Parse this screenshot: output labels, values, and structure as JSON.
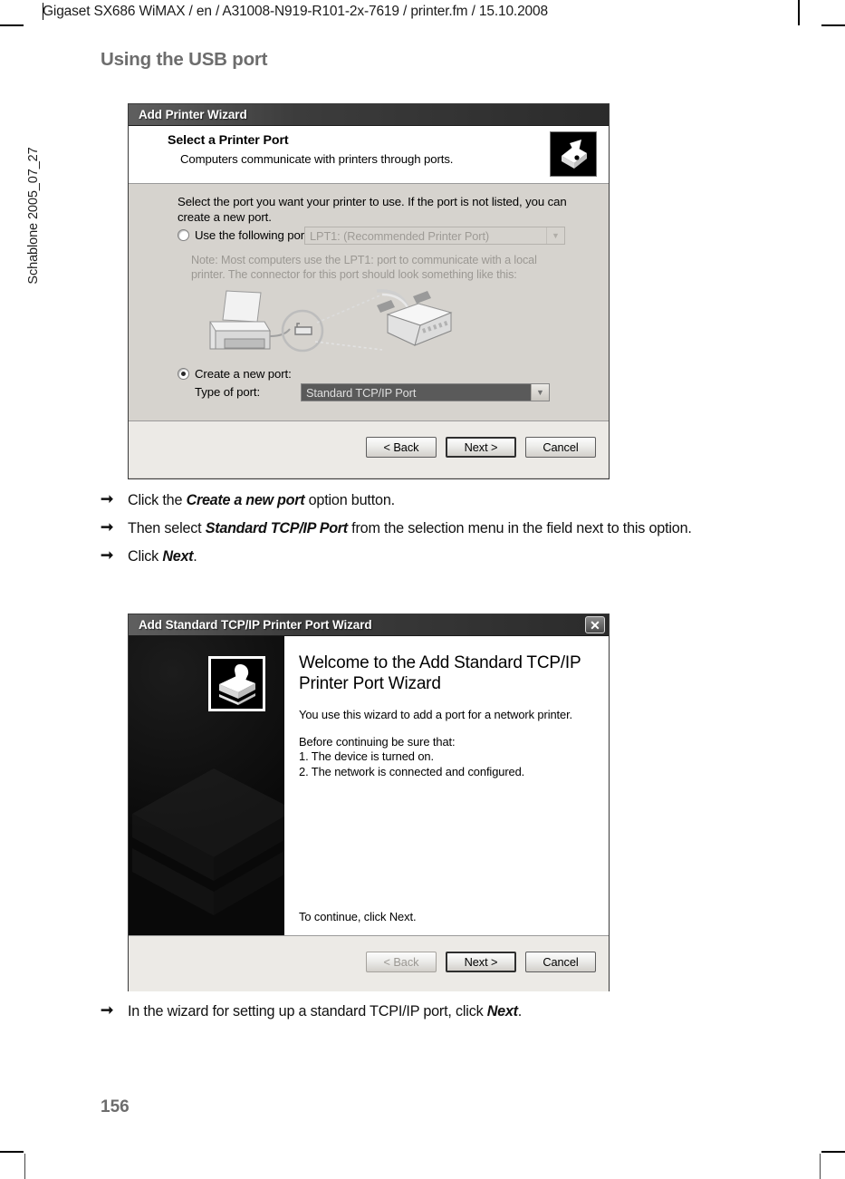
{
  "document": {
    "header": "Gigaset SX686 WiMAX / en / A31008-N919-R101-2x-7619 / printer.fm / 15.10.2008",
    "side_label": "Schablone 2005_07_27",
    "section_title": "Using the USB port",
    "page_number": "156"
  },
  "dialog_printer_port": {
    "title": "Add Printer Wizard",
    "header_title": "Select a Printer Port",
    "header_subtitle": "Computers communicate with printers through ports.",
    "header_icon": "printer-port-icon",
    "instruction": "Select the port you want your printer to use.  If the port is not listed, you can create a new port.",
    "use_following_port_label": "Use the following port:",
    "use_following_port_checked": false,
    "port_combo_value": "LPT1: (Recommended Printer Port)",
    "port_combo_disabled": true,
    "note": "Note: Most computers use the LPT1: port to communicate with a local printer. The connector for this port should look something like this:",
    "illustration": "printer-parallel-connector-illustration",
    "create_new_port_label": "Create a new port:",
    "create_new_port_checked": true,
    "type_of_port_label": "Type of port:",
    "type_combo_value": "Standard TCP/IP Port",
    "type_combo_selected": true,
    "buttons": {
      "back": "< Back",
      "next": "Next >",
      "cancel": "Cancel"
    }
  },
  "steps_after_first_dialog": [
    {
      "prefix": "Click the ",
      "bold": "Create a new port",
      "suffix": " option button."
    },
    {
      "prefix": "Then select ",
      "bold": "Standard TCP/IP Port",
      "suffix": " from the selection menu in the field next to this option."
    },
    {
      "prefix": "Click ",
      "bold": "Next",
      "suffix": "."
    }
  ],
  "dialog_tcpip_wizard": {
    "title": "Add Standard TCP/IP Printer Port Wizard",
    "close_label": "✕",
    "badge_icon": "printer-stack-icon",
    "welcome_title": "Welcome to the Add Standard TCP/IP Printer Port Wizard",
    "paragraph": "You use this wizard to add a port for a network printer.",
    "before_continuing": "Before continuing be sure that:",
    "checklist": [
      "1.  The device is turned on.",
      "2.  The network is connected and configured."
    ],
    "continue_text": "To continue, click Next.",
    "buttons": {
      "back": "< Back",
      "next": "Next >",
      "cancel": "Cancel"
    }
  },
  "steps_after_second_dialog": [
    {
      "prefix": "In the wizard for setting up a standard TCPI/IP port, click ",
      "bold": "Next",
      "suffix": "."
    }
  ]
}
